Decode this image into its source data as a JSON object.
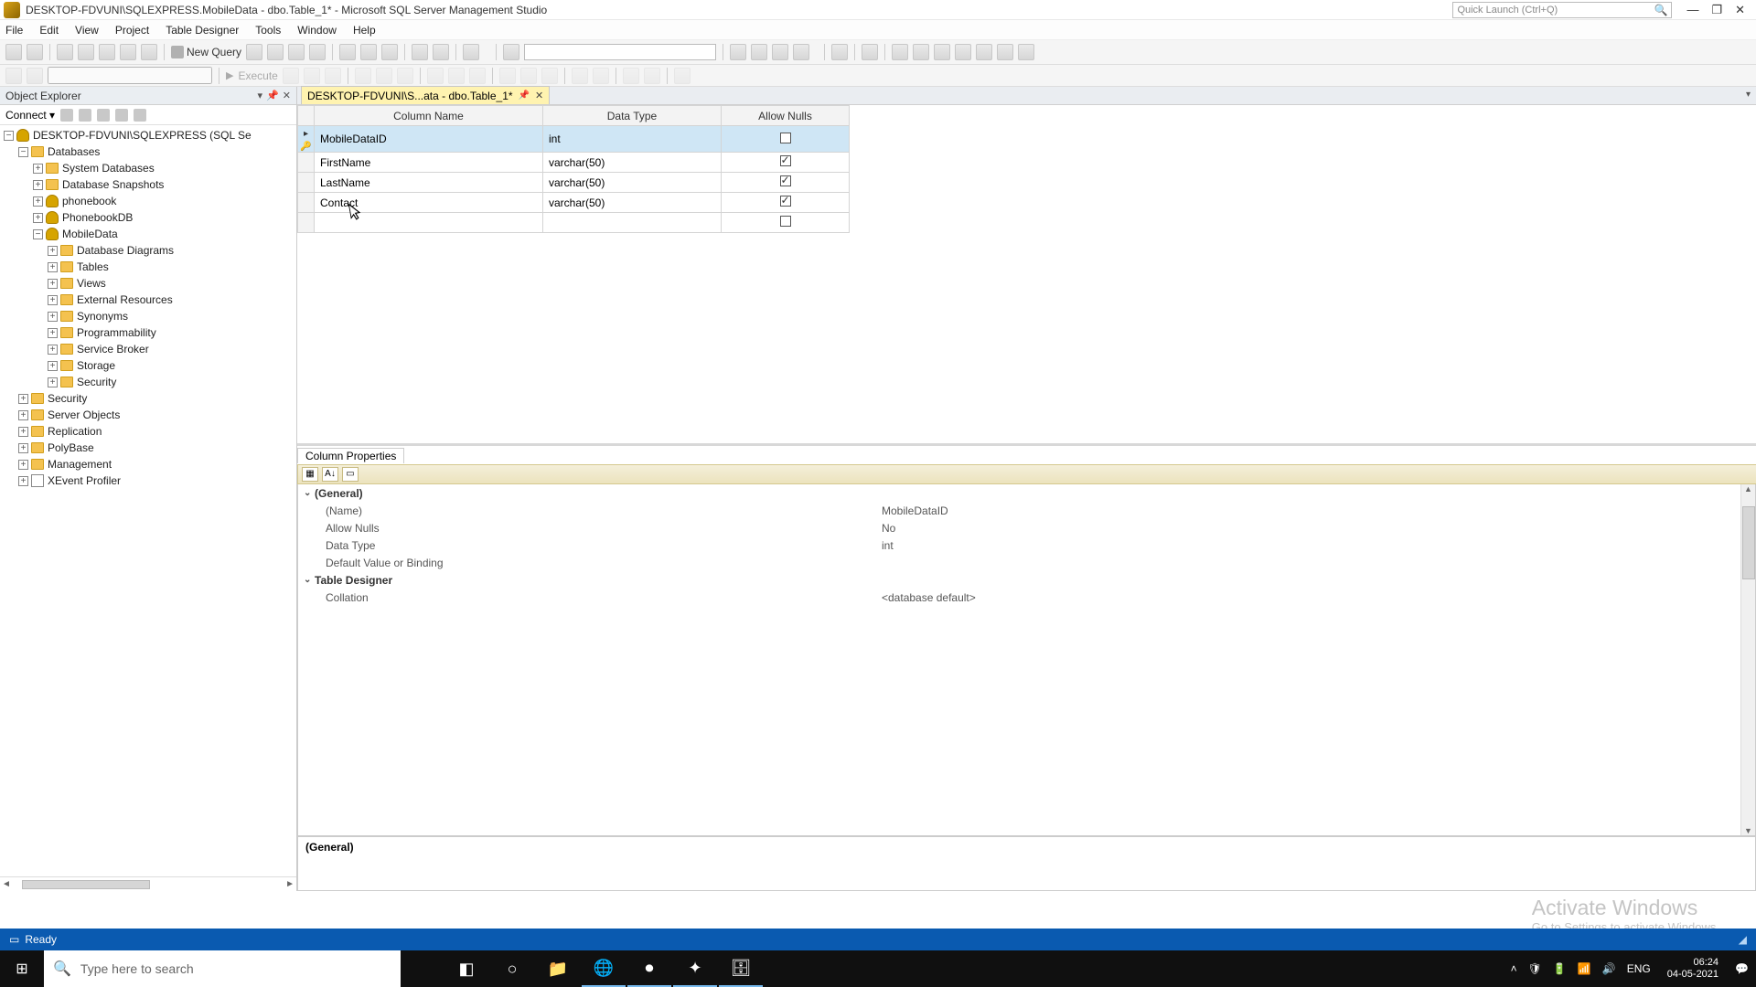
{
  "title_bar": {
    "title": "DESKTOP-FDVUNI\\SQLEXPRESS.MobileData - dbo.Table_1* - Microsoft SQL Server Management Studio",
    "quick_launch_placeholder": "Quick Launch (Ctrl+Q)"
  },
  "menu": {
    "file": "File",
    "edit": "Edit",
    "view": "View",
    "project": "Project",
    "table_designer": "Table Designer",
    "tools": "Tools",
    "window": "Window",
    "help": "Help"
  },
  "toolbar": {
    "new_query": "New Query"
  },
  "toolbar2": {
    "execute": "Execute"
  },
  "object_explorer": {
    "title": "Object Explorer",
    "connect": "Connect",
    "server": "DESKTOP-FDVUNI\\SQLEXPRESS (SQL Se",
    "nodes": {
      "databases": "Databases",
      "system_databases": "System Databases",
      "database_snapshots": "Database Snapshots",
      "phonebook": "phonebook",
      "phonebookdb": "PhonebookDB",
      "mobiledata": "MobileData",
      "database_diagrams": "Database Diagrams",
      "tables": "Tables",
      "views": "Views",
      "external_resources": "External Resources",
      "synonyms": "Synonyms",
      "programmability": "Programmability",
      "service_broker": "Service Broker",
      "storage": "Storage",
      "security_db": "Security",
      "security": "Security",
      "server_objects": "Server Objects",
      "replication": "Replication",
      "polybase": "PolyBase",
      "management": "Management",
      "xevent_profiler": "XEvent Profiler"
    }
  },
  "tab": {
    "label": "DESKTOP-FDVUNI\\S...ata - dbo.Table_1*"
  },
  "grid": {
    "headers": {
      "col": "Column Name",
      "type": "Data Type",
      "nulls": "Allow Nulls"
    },
    "rows": [
      {
        "name": "MobileDataID",
        "type": "int",
        "nulls": false,
        "pk": true
      },
      {
        "name": "FirstName",
        "type": "varchar(50)",
        "nulls": true,
        "pk": false
      },
      {
        "name": "LastName",
        "type": "varchar(50)",
        "nulls": true,
        "pk": false
      },
      {
        "name": "Contact",
        "type": "varchar(50)",
        "nulls": true,
        "pk": false
      }
    ]
  },
  "col_props": {
    "tab": "Column Properties",
    "group_general": "(General)",
    "name_label": "(Name)",
    "name_value": "MobileDataID",
    "allow_nulls_label": "Allow Nulls",
    "allow_nulls_value": "No",
    "data_type_label": "Data Type",
    "data_type_value": "int",
    "default_label": "Default Value or Binding",
    "group_td": "Table Designer",
    "collation_label": "Collation",
    "collation_value": "<database default>",
    "footer": "(General)"
  },
  "watermark": {
    "h": "Activate Windows",
    "s": "Go to Settings to activate Windows."
  },
  "status": {
    "ready": "Ready"
  },
  "taskbar": {
    "search": "Type here to search",
    "lang": "ENG",
    "time": "06:24",
    "date": "04-05-2021"
  }
}
